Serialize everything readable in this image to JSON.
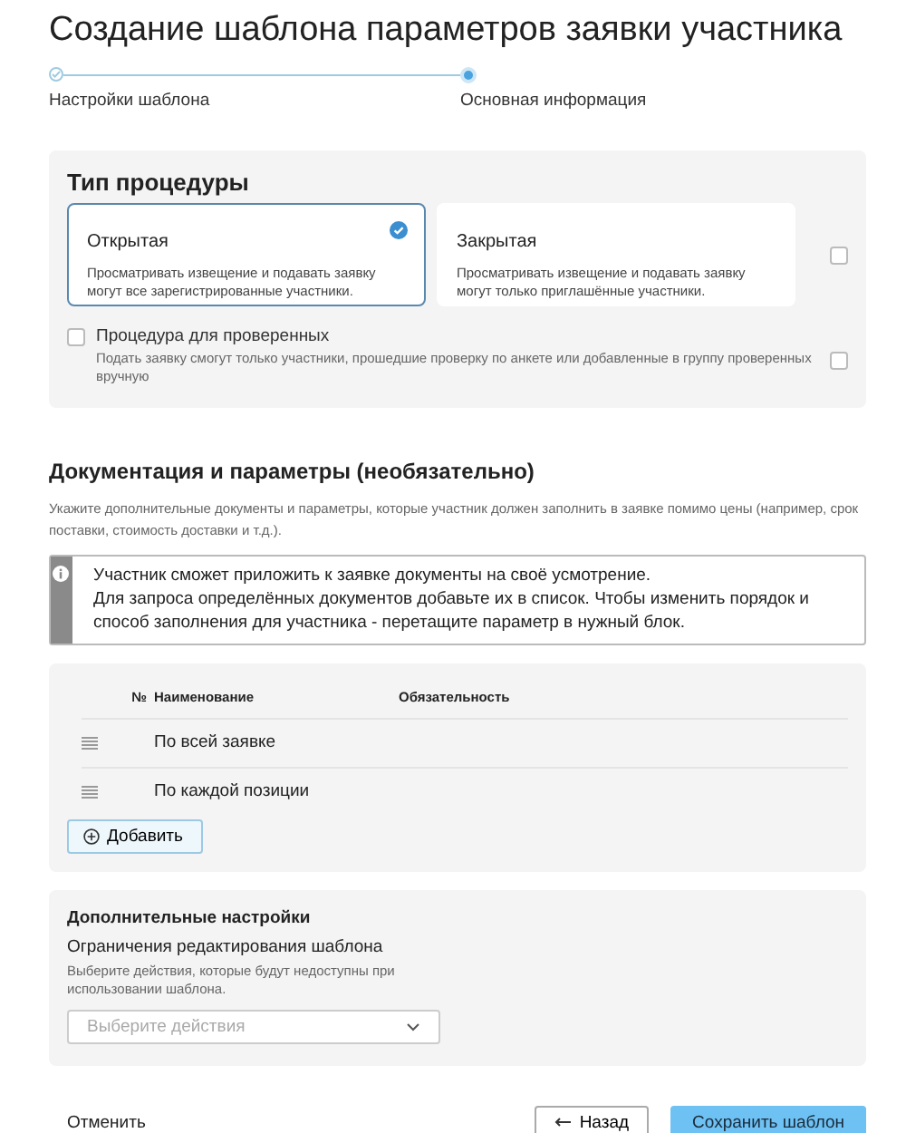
{
  "title": "Создание шаблона параметров заявки участника",
  "steps": [
    {
      "label": "Настройки шаблона",
      "completed": true,
      "selected": false
    },
    {
      "label": "Основная информация",
      "completed": false,
      "selected": true
    }
  ],
  "procedure_type": {
    "heading": "Тип процедуры",
    "options": [
      {
        "title": "Открытая",
        "description": "Просматривать извещение и подавать заявку могут все зарегистрированные участники.",
        "selected": true
      },
      {
        "title": "Закрытая",
        "description": "Просматривать извещение и подавать заявку могут только приглашённые участники.",
        "selected": false
      }
    ],
    "side_checkbox": {
      "checked": false
    },
    "verified": {
      "label": "Процедура для проверенных",
      "hint": "Подать заявку смогут только участники, прошедшие проверку по анкете или добавленные в группу проверенных вручную",
      "checked": false
    },
    "verified_side_checkbox": {
      "checked": false
    }
  },
  "documents": {
    "heading": "Документация и параметры (необязательно)",
    "description": "Укажите дополнительные документы и параметры, которые участник должен заполнить в заявке помимо цены (например, срок поставки, стоимость доставки и т.д.).",
    "info": [
      "Участник сможет приложить к заявке документы на своё усмотрение.",
      "Для запроса определённых документов добавьте их в список. Чтобы изменить порядок и способ заполнения для участника - перетащите параметр в нужный блок."
    ],
    "table": {
      "columns": [
        "№",
        "Наименование",
        "Обязательность"
      ],
      "rows": [
        {
          "name": "По всей заявке"
        },
        {
          "name": "По каждой позиции"
        }
      ]
    },
    "add_button": "Добавить"
  },
  "extra_settings": {
    "heading": "Дополнительные настройки",
    "subheading": "Ограничения редактирования шаблона",
    "hint": "Выберите действия, которые будут недоступны при использовании шаблона.",
    "select": {
      "placeholder": "Выберите действия"
    }
  },
  "footer": {
    "cancel": "Отменить",
    "back": "Назад",
    "save": "Сохранить шаблон"
  }
}
